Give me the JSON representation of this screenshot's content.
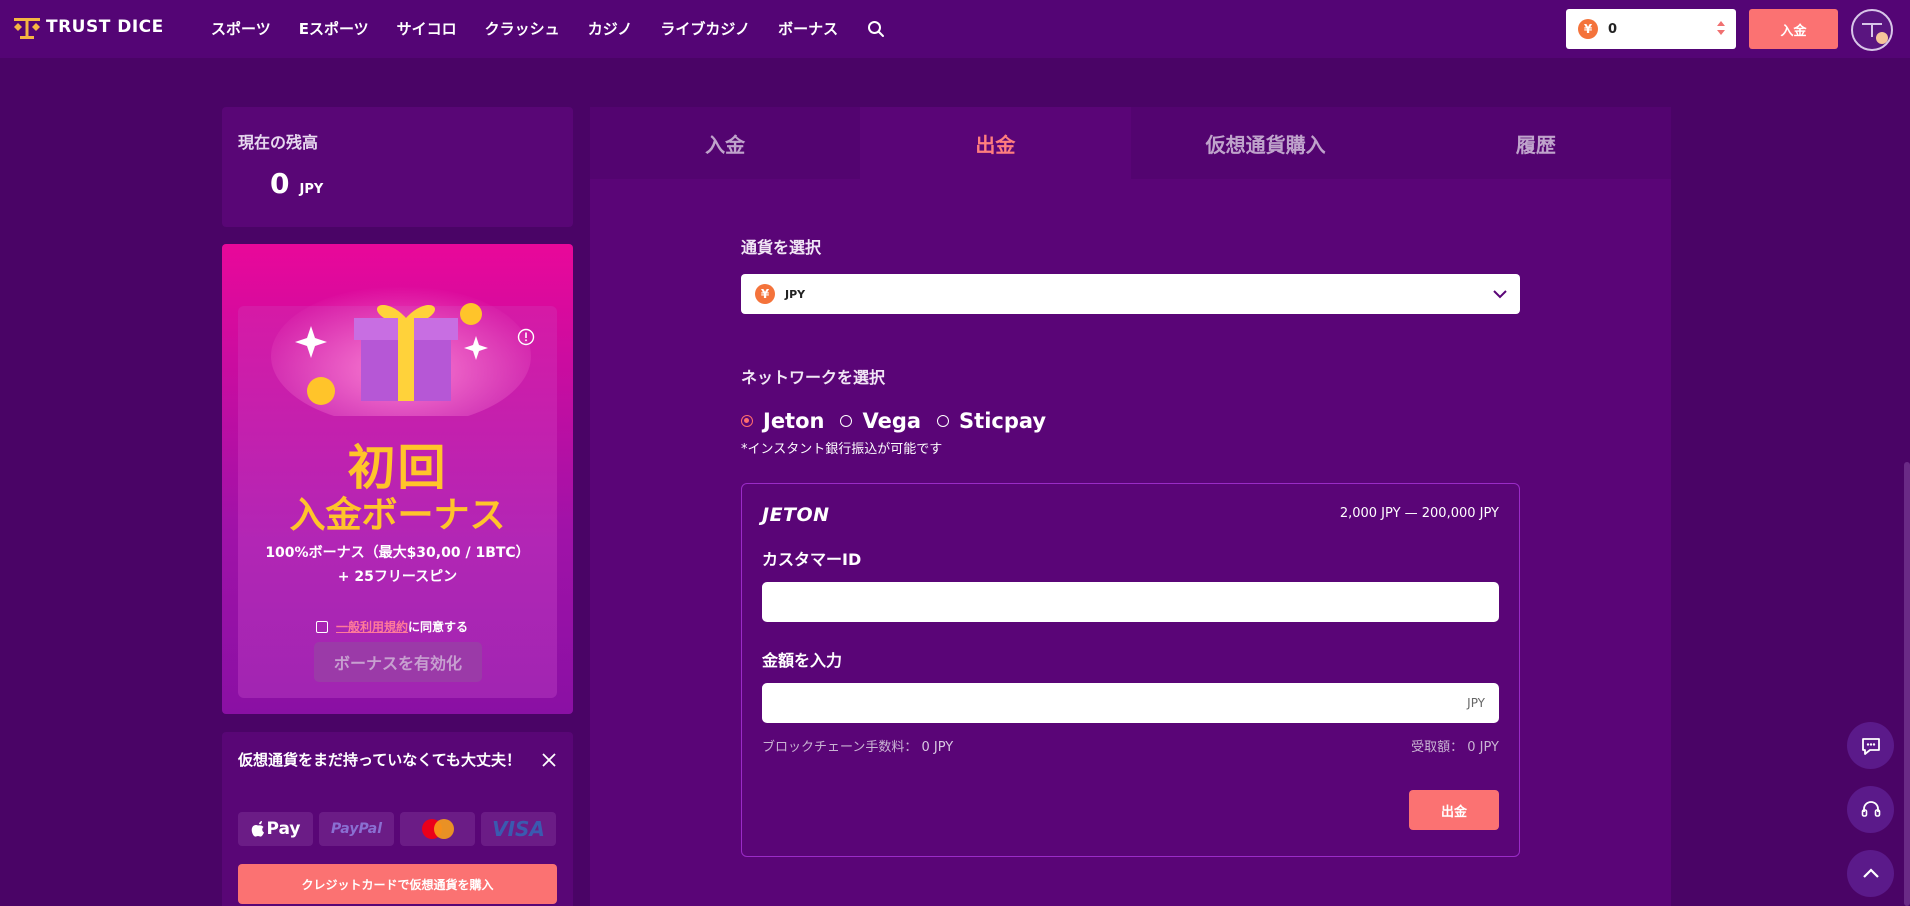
{
  "header": {
    "brand": "TRUST DICE",
    "nav": [
      "スポーツ",
      "Eスポーツ",
      "サイコロ",
      "クラッシュ",
      "カジノ",
      "ライブカジノ",
      "ボーナス"
    ],
    "balance_symbol": "¥",
    "balance_value": "0",
    "deposit_label": "入金"
  },
  "left": {
    "balance_label": "現在の残高",
    "balance_amount": "0",
    "balance_currency": "JPY",
    "bonus": {
      "title1": "初回",
      "title2": "入金ボーナス",
      "line1": "100%ボーナス（最大$30,00 / 1BTC）",
      "line2": "+ 25フリースピン",
      "terms_link": "一般利用規約",
      "terms_suffix": "に同意する",
      "activate_label": "ボーナスを有効化"
    },
    "crypto": {
      "title": "仮想通貨をまだ持っていなくても大丈夫！",
      "apple_pay": "Pay",
      "paypal": "PayPal",
      "visa": "VISA",
      "buy_label": "クレジットカードで仮想通貨を購入"
    }
  },
  "main": {
    "tabs": [
      {
        "label": "入金",
        "active": false
      },
      {
        "label": "出金",
        "active": true
      },
      {
        "label": "仮想通貨購入",
        "active": false
      },
      {
        "label": "履歴",
        "active": false
      }
    ],
    "currency_label": "通貨を選択",
    "currency_symbol": "¥",
    "currency_code": "JPY",
    "network_label": "ネットワークを選択",
    "networks": [
      {
        "name": "Jeton",
        "selected": true
      },
      {
        "name": "Vega",
        "selected": false
      },
      {
        "name": "Sticpay",
        "selected": false
      }
    ],
    "network_note": "*インスタント銀行振込が可能です",
    "jeton": {
      "logo": "JETON",
      "range": "2,000 JPY — 200,000 JPY",
      "customer_id_label": "カスタマーID",
      "customer_id_value": "",
      "amount_label": "金額を入力",
      "amount_value": "",
      "amount_suffix": "JPY",
      "fee_label": "ブロックチェーン手数料：",
      "fee_value": "0 JPY",
      "receive_label": "受取額：",
      "receive_value": "0 JPY",
      "withdraw_label": "出金"
    }
  },
  "colors": {
    "bg": "#4a0466",
    "accent": "#fb7272",
    "gold": "#ffc42a",
    "magenta": "#e9089a"
  }
}
